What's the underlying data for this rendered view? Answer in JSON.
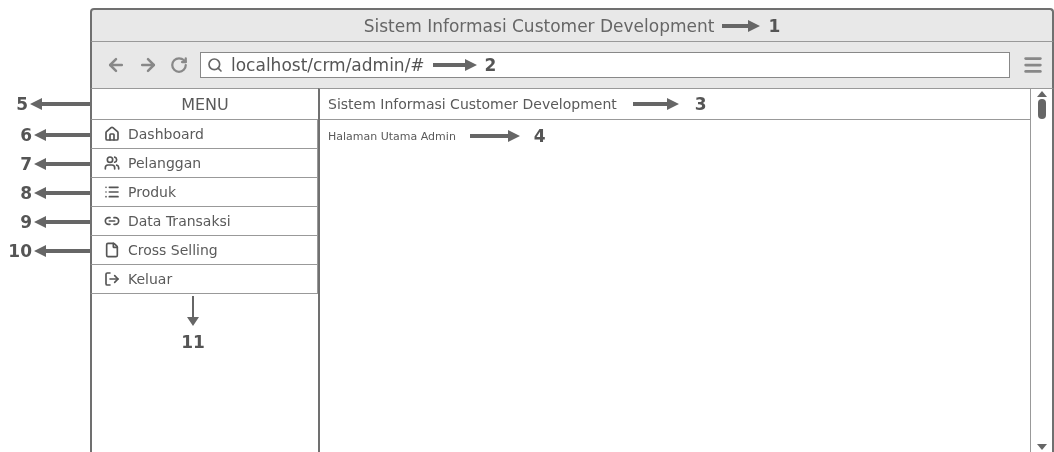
{
  "window": {
    "title": "Sistem Informasi Customer Development",
    "callout": "1"
  },
  "browser": {
    "url": "localhost/crm/admin/#",
    "callout": "2"
  },
  "menu": {
    "title": "MENU",
    "callout": "5",
    "items": [
      {
        "label": "Dashboard",
        "kind": "home",
        "callout": "6",
        "callout_below": false
      },
      {
        "label": "Pelanggan",
        "kind": "users",
        "callout": "7",
        "callout_below": false
      },
      {
        "label": "Produk",
        "kind": "list",
        "callout": "8",
        "callout_below": false
      },
      {
        "label": "Data Transaksi",
        "kind": "link",
        "callout": "9",
        "callout_below": false
      },
      {
        "label": "Cross Selling",
        "kind": "file",
        "callout": "10",
        "callout_below": false
      },
      {
        "label": "Keluar",
        "kind": "exit",
        "callout": "11",
        "callout_below": true
      }
    ]
  },
  "content": {
    "header": "Sistem Informasi Customer Development",
    "header_callout": "3",
    "subtitle": "Halaman Utama Admin",
    "subtitle_callout": "4"
  }
}
